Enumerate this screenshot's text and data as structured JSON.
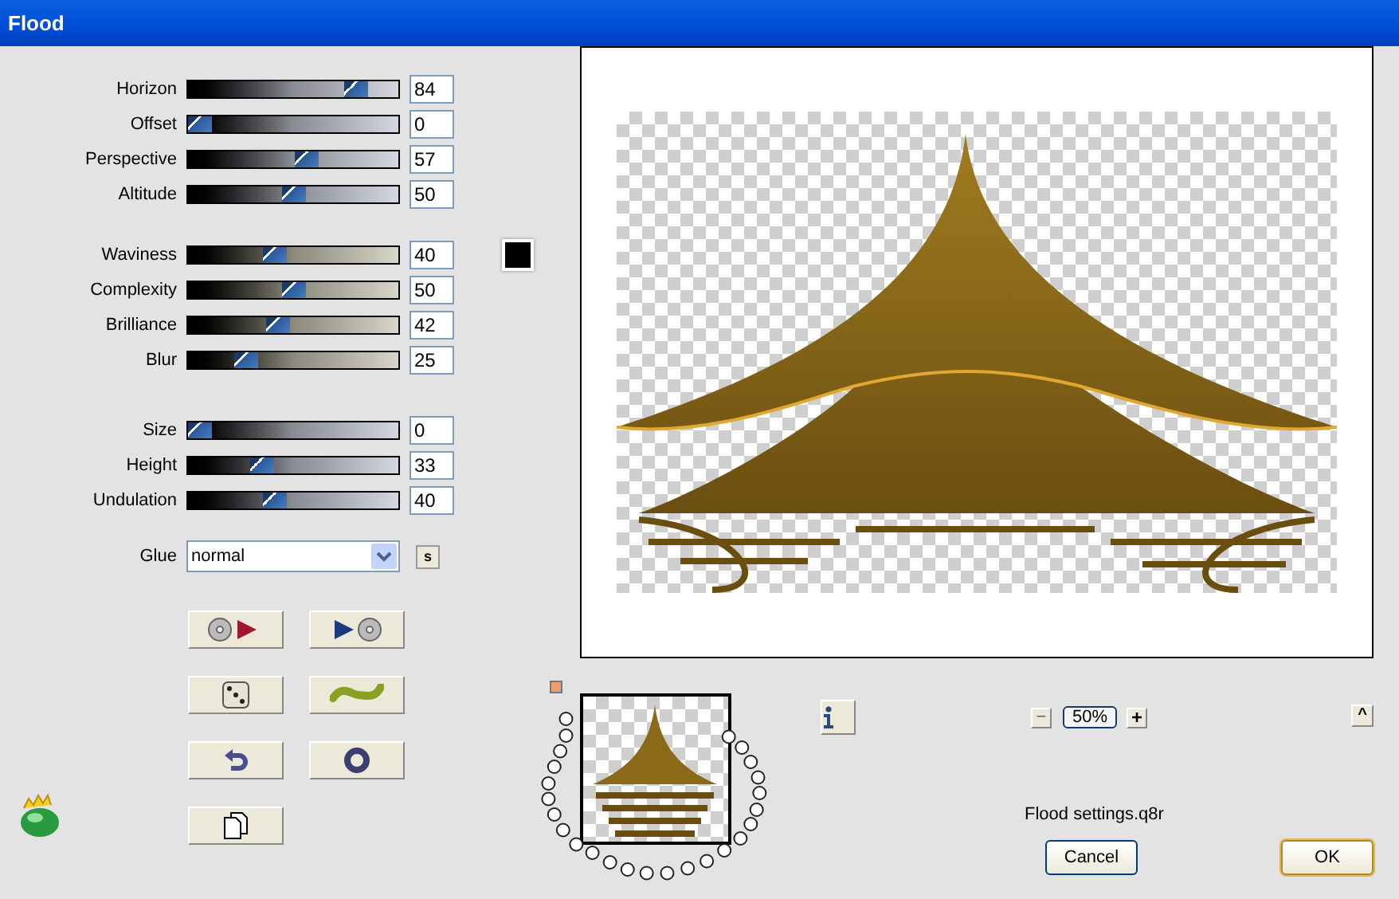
{
  "window": {
    "title": "Flood"
  },
  "slider_groups": [
    {
      "sliders": [
        {
          "label": "Horizon",
          "value": "84",
          "level": 0.84
        },
        {
          "label": "Offset",
          "value": "0",
          "level": 0
        },
        {
          "label": "Perspective",
          "value": "57",
          "level": 0.57
        },
        {
          "label": "Altitude",
          "value": "50",
          "level": 0.5
        }
      ]
    },
    {
      "sliders": [
        {
          "label": "Waviness",
          "value": "40",
          "level": 0.4
        },
        {
          "label": "Complexity",
          "value": "50",
          "level": 0.5
        },
        {
          "label": "Brilliance",
          "value": "42",
          "level": 0.42
        },
        {
          "label": "Blur",
          "value": "25",
          "level": 0.25
        }
      ]
    },
    {
      "sliders": [
        {
          "label": "Size",
          "value": "0",
          "level": 0
        },
        {
          "label": "Height",
          "value": "33",
          "level": 0.33
        },
        {
          "label": "Undulation",
          "value": "40",
          "level": 0.4
        }
      ]
    }
  ],
  "color_swatch": {
    "color": "#000000"
  },
  "glue": {
    "label": "Glue",
    "value": "normal",
    "button": "s"
  },
  "tool_buttons": [
    {
      "kind": "load"
    },
    {
      "kind": "save"
    },
    {
      "kind": "random"
    },
    {
      "kind": "wave"
    },
    {
      "kind": "undo"
    },
    {
      "kind": "reset"
    },
    {
      "kind": "copy"
    }
  ],
  "zoom": {
    "minus": "−",
    "value": "50%",
    "plus": "+"
  },
  "expand_button": "^",
  "preset_file": "Flood settings.q8r",
  "buttons": [
    {
      "label": "Cancel",
      "default": false
    },
    {
      "label": "OK",
      "default": true
    }
  ]
}
